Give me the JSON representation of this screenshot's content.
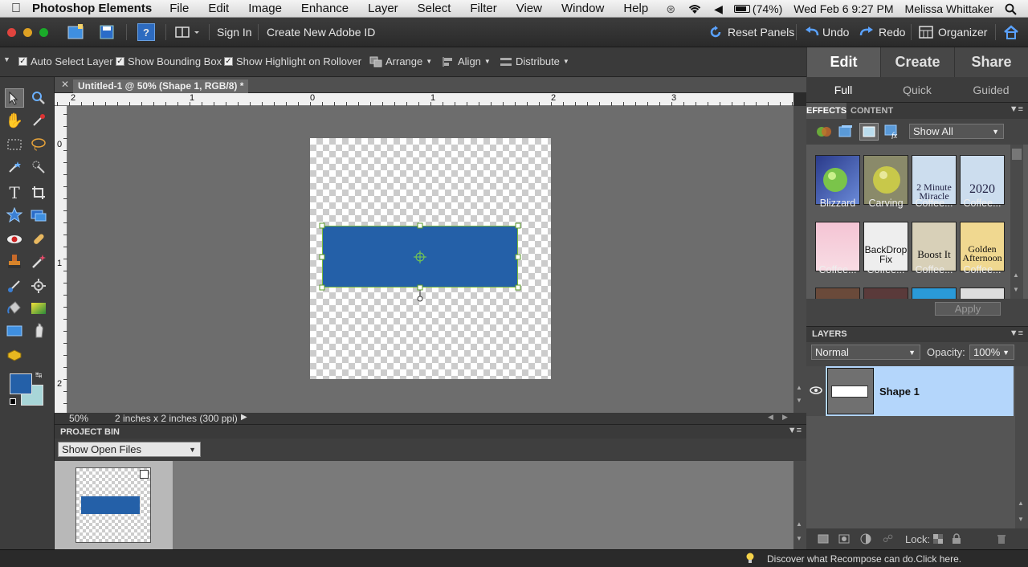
{
  "menubar": {
    "app_name": "Photoshop Elements",
    "items": [
      "File",
      "Edit",
      "Image",
      "Enhance",
      "Layer",
      "Select",
      "Filter",
      "View",
      "Window",
      "Help"
    ],
    "battery": "(74%)",
    "datetime": "Wed Feb 6  9:27 PM",
    "user": "Melissa Whittaker"
  },
  "toolbar": {
    "help_label": "?",
    "sign_in": "Sign In",
    "create_id": "Create New Adobe ID",
    "reset_panels": "Reset Panels",
    "undo": "Undo",
    "redo": "Redo",
    "organizer": "Organizer"
  },
  "options": {
    "auto_select": "Auto Select Layer",
    "show_bounding": "Show Bounding Box",
    "show_highlight": "Show Highlight on Rollover",
    "arrange": "Arrange",
    "align": "Align",
    "distribute": "Distribute"
  },
  "mode_tabs": [
    "Edit",
    "Create",
    "Share"
  ],
  "sub_tabs": [
    "Full",
    "Quick",
    "Guided"
  ],
  "document": {
    "tab_title": "Untitled-1 @ 50% (Shape 1, RGB/8) *",
    "zoom": "50%",
    "info": "2 inches x 2 inches (300 ppi)"
  },
  "rulers": {
    "h_labels": [
      "2",
      "1",
      "0",
      "1",
      "2",
      "3"
    ],
    "v_labels": [
      "0",
      "1",
      "2"
    ]
  },
  "colors": {
    "foreground": "#2460a8",
    "background": "#a8d6d8",
    "shape_fill": "#2460a8"
  },
  "project_bin": {
    "title": "PROJECT BIN",
    "dropdown": "Show Open Files"
  },
  "effects": {
    "tab_effects": "EFFECTS",
    "tab_content": "CONTENT",
    "filter": "Show All",
    "thumbs": [
      "Blizzard",
      "Carving",
      "Coffee...",
      "Coffee...",
      "Coffee...",
      "Coffee...",
      "Coffee...",
      "Coffee..."
    ],
    "thumb_texts": [
      "",
      "",
      "2 Minute Miracle",
      "2020",
      "",
      "BackDrop Fix",
      "Boost It",
      "Golden Afternoon"
    ],
    "apply": "Apply"
  },
  "layers": {
    "title": "LAYERS",
    "blend_mode": "Normal",
    "opacity_label": "Opacity:",
    "opacity_value": "100%",
    "layer_name": "Shape 1",
    "lock_label": "Lock:"
  },
  "hint": "Discover what Recompose can do.Click here."
}
